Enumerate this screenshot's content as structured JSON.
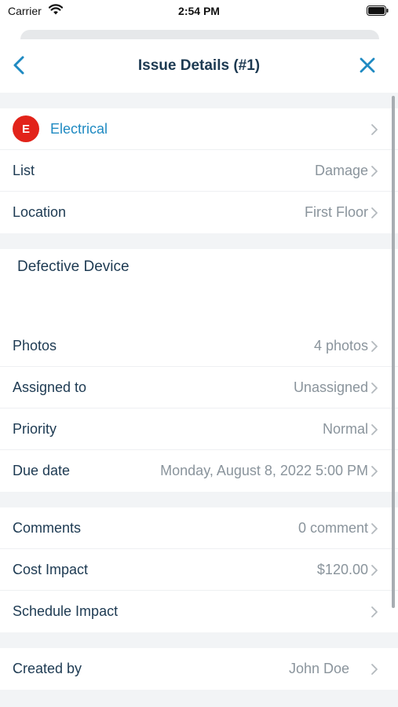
{
  "status_bar": {
    "carrier": "Carrier",
    "time": "2:54 PM",
    "icons": [
      "wifi-icon",
      "battery-icon"
    ]
  },
  "nav": {
    "title": "Issue Details (#1)",
    "back_icon": "chevron-left-icon",
    "close_icon": "close-icon",
    "accent_color": "#1f8ac2"
  },
  "category": {
    "badge": "E",
    "label": "Electrical",
    "badge_color": "#e2231a"
  },
  "fields_1": [
    {
      "label": "List",
      "value": "Damage"
    },
    {
      "label": "Location",
      "value": "First Floor"
    }
  ],
  "description": "Defective Device",
  "fields_2": [
    {
      "label": "Photos",
      "value": "4 photos"
    },
    {
      "label": "Assigned to",
      "value": "Unassigned"
    },
    {
      "label": "Priority",
      "value": "Normal"
    },
    {
      "label": "Due date",
      "value": "Monday, August 8, 2022 5:00 PM"
    }
  ],
  "fields_3": [
    {
      "label": "Comments",
      "value": "0 comment"
    },
    {
      "label": "Cost Impact",
      "value": "$120.00"
    },
    {
      "label": "Schedule Impact",
      "value": ""
    }
  ],
  "fields_4": [
    {
      "label": "Created by",
      "value": "John Doe"
    }
  ]
}
